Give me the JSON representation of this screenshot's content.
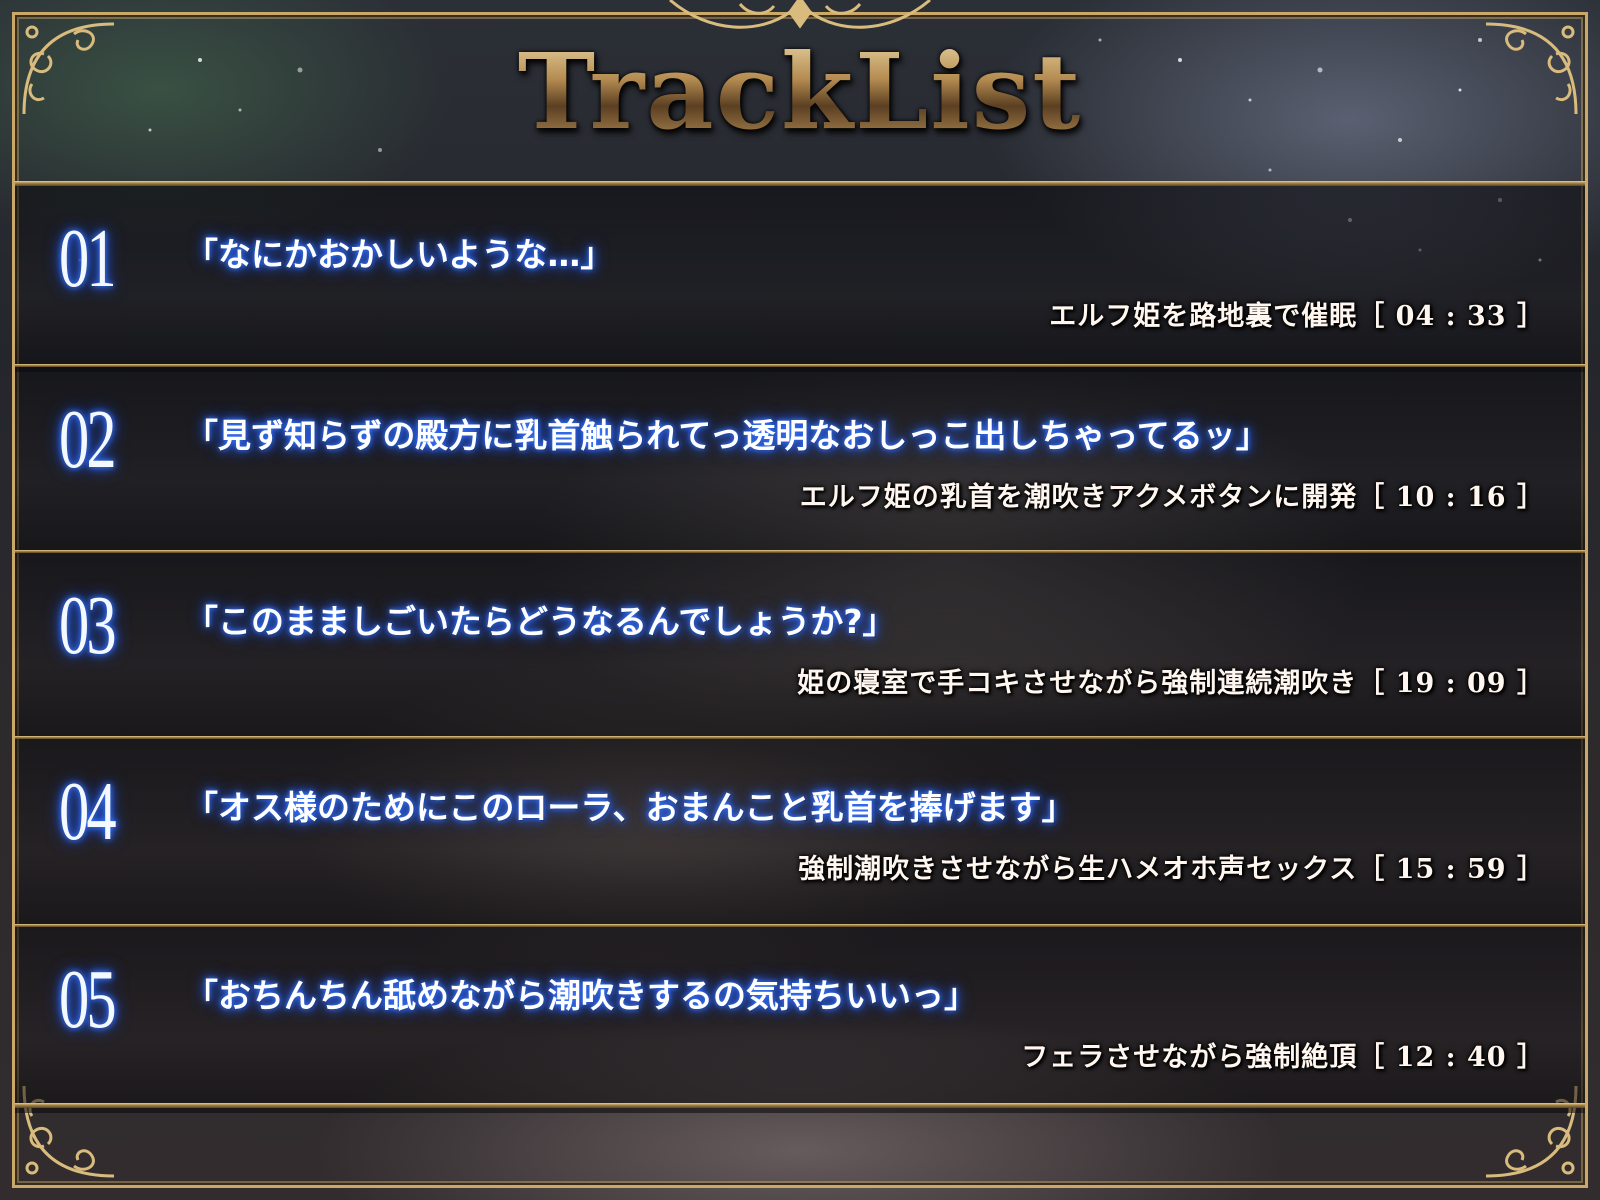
{
  "header": {
    "title": "TrackList"
  },
  "tracks": [
    {
      "number": "01",
      "title": "「なにかおかしいような…」",
      "subtitle": "エルフ姫を路地裏で催眠［ 04 : 33 ］"
    },
    {
      "number": "02",
      "title": "「見ず知らずの殿方に乳首触られてっ透明なおしっこ出しちゃってるッ」",
      "subtitle": "エルフ姫の乳首を潮吹きアクメボタンに開発［ 10 : 16 ］"
    },
    {
      "number": "03",
      "title": "「このまましごいたらどうなるんでしょうか?」",
      "subtitle": "姫の寝室で手コキさせながら強制連続潮吹き［ 19 : 09 ］"
    },
    {
      "number": "04",
      "title": "「オス様のためにこのローラ、おまんこと乳首を捧げます」",
      "subtitle": "強制潮吹きさせながら生ハメオホ声セックス［ 15 : 59 ］"
    },
    {
      "number": "05",
      "title": "「おちんちん舐めながら潮吹きするの気持ちいいっ」",
      "subtitle": "フェラさせながら強制絶頂［ 12 : 40 ］"
    }
  ],
  "colors": {
    "gold": "#c9a869",
    "glow_blue": "#2a63ff"
  }
}
